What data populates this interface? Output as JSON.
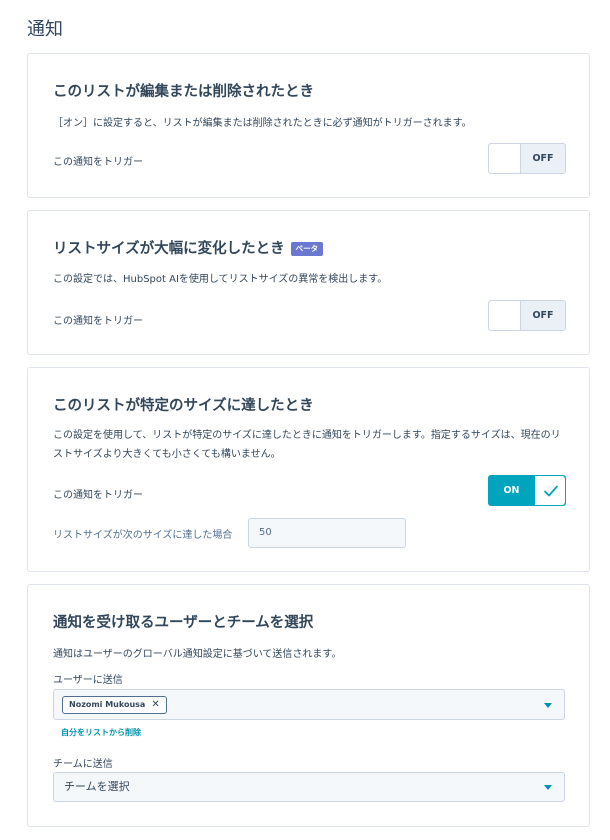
{
  "page": {
    "title": "通知"
  },
  "cards": {
    "edited": {
      "title": "このリストが編集または削除されたとき",
      "description": "［オン］に設定すると、リストが編集または削除されたときに必ず通知がトリガーされます。",
      "trigger_label": "この通知をトリガー",
      "toggle_label": "OFF",
      "toggle_state": "off"
    },
    "size_change": {
      "title": "リストサイズが大幅に変化したとき",
      "badge": "ベータ",
      "description": "この設定では、HubSpot AIを使用してリストサイズの異常を検出します。",
      "trigger_label": "この通知をトリガー",
      "toggle_label": "OFF",
      "toggle_state": "off"
    },
    "size_reached": {
      "title": "このリストが特定のサイズに達したとき",
      "description": "この設定を使用して、リストが特定のサイズに達したときに通知をトリガーします。指定するサイズは、現在のリストサイズより大きくても小さくても構いません。",
      "trigger_label": "この通知をトリガー",
      "toggle_label": "ON",
      "toggle_state": "on",
      "size_label": "リストサイズが次のサイズに達した場合",
      "size_value": "50"
    },
    "recipients": {
      "title": "通知を受け取るユーザーとチームを選択",
      "description": "通知はユーザーのグローバル通知設定に基づいて送信されます。",
      "users_label": "ユーザーに送信",
      "selected_user": "Nozomi Mukousa",
      "remove_self_link": "自分をリストから削除",
      "teams_label": "チームに送信",
      "teams_placeholder": "チームを選択"
    }
  },
  "colors": {
    "accent": "#00a4bd",
    "link": "#0091ae",
    "badge": "#6a78d1",
    "text": "#33475b",
    "border": "#dfe3eb"
  },
  "icons": {
    "check": "check-icon",
    "remove": "close-icon",
    "dropdown": "chevron-down-icon"
  }
}
